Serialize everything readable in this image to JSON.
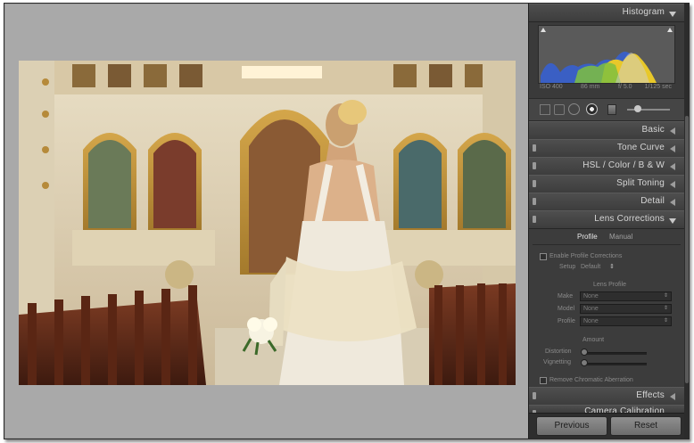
{
  "panel": {
    "histogram": {
      "title": "Histogram",
      "info": [
        "ISO 400",
        "86 mm",
        "f/ 5.0",
        "1/125 sec"
      ]
    },
    "sections": {
      "basic": "Basic",
      "tone_curve": "Tone Curve",
      "hsl_color_bw": "HSL  /  Color  /  B & W",
      "split_toning": "Split Toning",
      "detail": "Detail",
      "lens_corrections": "Lens Corrections",
      "effects": "Effects",
      "camera_calibration": "Camera Calibration"
    },
    "lens": {
      "tabs": [
        "Profile",
        "Manual"
      ],
      "enable_label": "Enable Profile Corrections",
      "setup_label": "Setup",
      "setup_value": "Default",
      "lens_profile_title": "Lens Profile",
      "make_label": "Make",
      "make_value": "None",
      "model_label": "Model",
      "model_value": "None",
      "profile_label": "Profile",
      "profile_value": "None",
      "amount_title": "Amount",
      "distortion_label": "Distortion",
      "vignetting_label": "Vignetting",
      "remove_ca_label": "Remove Chromatic Aberration"
    },
    "buttons": {
      "previous": "Previous",
      "reset": "Reset"
    }
  },
  "colors": {
    "panel_bg": "#3a3a3a",
    "canvas_bg": "#a9a9a9",
    "histogram_blue": "#3a5fc4",
    "histogram_yellow": "#e8c82a",
    "histogram_green": "#7fbf3f"
  }
}
